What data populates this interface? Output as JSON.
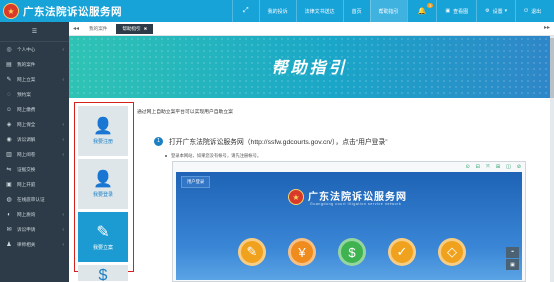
{
  "header": {
    "app_title": "广东法院诉讼服务网",
    "nav": [
      "我的投诉",
      "法律文书送达",
      "首页",
      "帮助指引",
      "",
      "查看图",
      "设置",
      "退出"
    ],
    "notification_count": "3"
  },
  "sidebar": {
    "toggle_label": "☰",
    "items": [
      {
        "label": "个人中心",
        "icon": "◎",
        "has_children": true
      },
      {
        "label": "我的案件",
        "icon": "▤",
        "has_children": false
      },
      {
        "label": "网上立案",
        "icon": "✎",
        "has_children": true
      },
      {
        "label": "预约案",
        "icon": "◌",
        "has_children": false
      },
      {
        "label": "网上缴费",
        "icon": "☺",
        "has_children": false
      },
      {
        "label": "网上保全",
        "icon": "◈",
        "has_children": true
      },
      {
        "label": "诉讼调解",
        "icon": "◉",
        "has_children": true
      },
      {
        "label": "网上阅卷",
        "icon": "▥",
        "has_children": true
      },
      {
        "label": "证据交换",
        "icon": "⇋",
        "has_children": false
      },
      {
        "label": "网上开庭",
        "icon": "▣",
        "has_children": false
      },
      {
        "label": "在线庭审认证",
        "icon": "◍",
        "has_children": false
      },
      {
        "label": "网上质询",
        "icon": "◐",
        "has_children": true
      },
      {
        "label": "诉讼申请",
        "icon": "✉",
        "has_children": true
      },
      {
        "label": "律师相关",
        "icon": "♟",
        "has_children": true
      }
    ]
  },
  "tabs": {
    "prev": "◂◂",
    "items": [
      "我的案件",
      "帮助指引"
    ],
    "close_glyph": "✖",
    "next": "▸▸"
  },
  "banner": {
    "title": "帮助指引"
  },
  "help": {
    "tiles": [
      {
        "label": "我要注册",
        "icon": "👤"
      },
      {
        "label": "我要登录",
        "icon": "👤"
      },
      {
        "label": "我要立案",
        "icon": "✎"
      },
      {
        "label": "",
        "icon": "$"
      }
    ],
    "intro_text": "通过网上自助立案平台可以实现用户自助立案",
    "step_number": "1",
    "step_text": "打开广东法院诉讼服务网（http://ssfw.gdcourts.gov.cn/），点击“用户登录”",
    "tip_text": "登录本网站，如果您没有帐号，请先注册帐号。",
    "browser_tools": [
      "⊙",
      "⊟",
      "⤧",
      "⊞",
      "◫",
      "⊘"
    ],
    "site": {
      "login_button": "用户登录",
      "title": "广东法院诉讼服务网",
      "subtitle": "Guangdong court litigation service network",
      "circle_icons": [
        "✎",
        "¥",
        "$",
        "✓",
        "◇"
      ]
    },
    "float_buttons": [
      "❝",
      "▣"
    ]
  },
  "colors": {
    "topbar": "#17a2d8",
    "sidebar": "#2c3b47",
    "banner_start": "#2fc3b4",
    "banner_end": "#2f86c8",
    "highlight_border": "#d6201c",
    "circle_colors": [
      "#f0a21e",
      "#f08c1e",
      "#3fb34f",
      "#f0a21e",
      "#f0a21e"
    ]
  }
}
